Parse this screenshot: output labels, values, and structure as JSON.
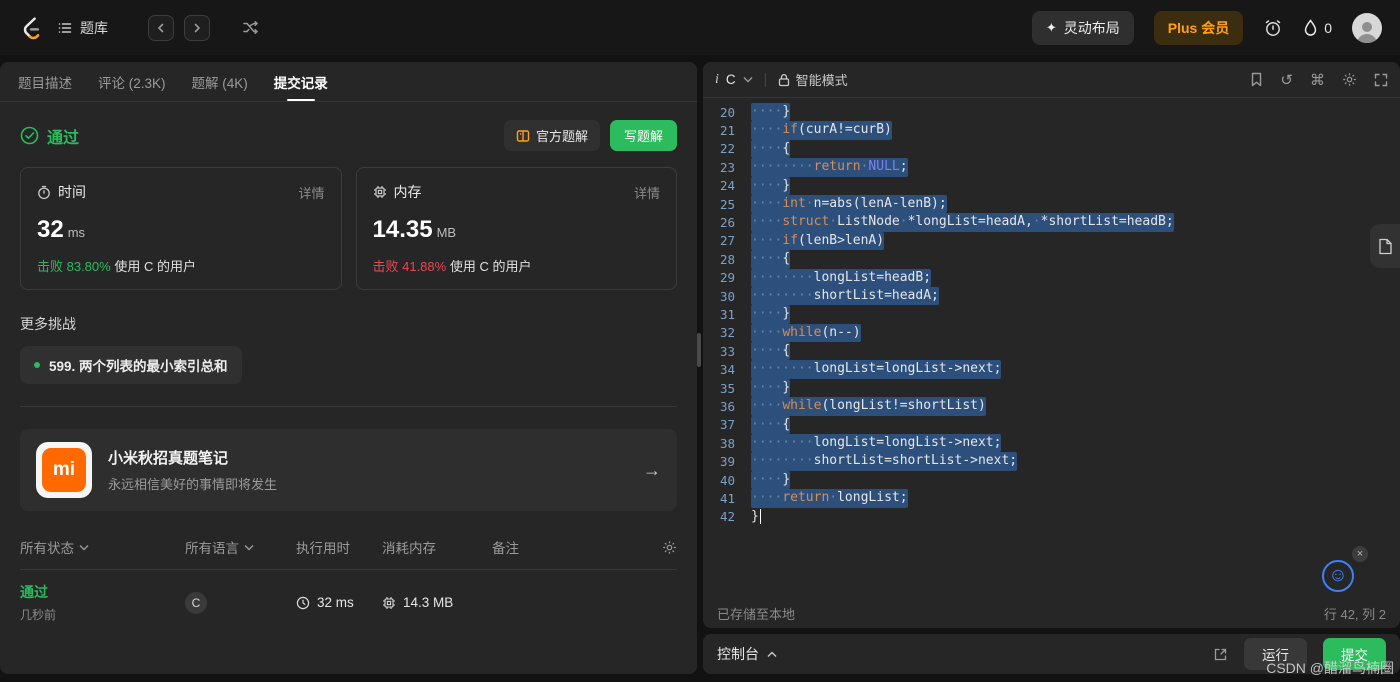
{
  "colors": {
    "green": "#2cbb5d",
    "red": "#f04452",
    "orange": "#ffa116",
    "sel": "#2d4f7c",
    "kw": "#d78d54",
    "const": "#7a83f0",
    "lineno": "#7da0c8"
  },
  "icons": {
    "command": "⌘",
    "reset": "↺",
    "arrow_right": "→",
    "sparkle": "✦",
    "gear": "⚙",
    "smiley": "☺",
    "close": "×",
    "info": "i"
  },
  "topbar": {
    "problem_bank": "题库",
    "layout_button": "灵动布局",
    "plus_button": "Plus 会员",
    "drop_count": "0"
  },
  "left_panel": {
    "tabs": [
      {
        "label": "题目描述"
      },
      {
        "label": "评论 (2.3K)"
      },
      {
        "label": "题解 (4K)"
      },
      {
        "label": "提交记录"
      }
    ],
    "result": {
      "status": "通过",
      "official_solution": "官方题解",
      "write_solution": "写题解"
    },
    "stats": [
      {
        "title": "时间",
        "detail": "详情",
        "value": "32",
        "unit": "ms",
        "beat": "击败 83.80%",
        "users": "使用 C 的用户"
      },
      {
        "title": "内存",
        "detail": "详情",
        "value": "14.35",
        "unit": "MB",
        "beat": "击败 41.88%",
        "users": "使用 C 的用户"
      }
    ],
    "more_challenges": {
      "title": "更多挑战",
      "challenge": "599. 两个列表的最小索引总和"
    },
    "promo": {
      "logo_text": "mi",
      "title": "小米秋招真题笔记",
      "subtitle": "永远相信美好的事情即将发生"
    },
    "table": {
      "filter_status": "所有状态",
      "filter_lang": "所有语言",
      "col_runtime": "执行用时",
      "col_memory": "消耗内存",
      "col_note": "备注",
      "row": {
        "status": "通过",
        "ago": "几秒前",
        "lang": "C",
        "runtime": "32 ms",
        "memory": "14.3 MB"
      }
    }
  },
  "editor": {
    "lang": "C",
    "mode": "智能模式",
    "status_left": "已存储至本地",
    "status_right": "行 42, 列 2",
    "lines": [
      {
        "n": 20,
        "indent": 4,
        "sel": true,
        "tokens": [
          [
            "p",
            "}"
          ]
        ]
      },
      {
        "n": 21,
        "indent": 4,
        "sel": true,
        "tokens": [
          [
            "k",
            "if"
          ],
          [
            "p",
            "(curA!=curB)"
          ]
        ]
      },
      {
        "n": 22,
        "indent": 4,
        "sel": true,
        "tokens": [
          [
            "p",
            "{"
          ]
        ]
      },
      {
        "n": 23,
        "indent": 8,
        "sel": true,
        "tokens": [
          [
            "k",
            "return"
          ],
          [
            "p",
            " "
          ],
          [
            "c",
            "NULL"
          ],
          [
            "p",
            ";"
          ]
        ]
      },
      {
        "n": 24,
        "indent": 4,
        "sel": true,
        "tokens": [
          [
            "p",
            "}"
          ]
        ]
      },
      {
        "n": 25,
        "indent": 4,
        "sel": true,
        "tokens": [
          [
            "k",
            "int"
          ],
          [
            "p",
            " n=abs(lenA-lenB);"
          ]
        ]
      },
      {
        "n": 26,
        "indent": 4,
        "sel": true,
        "tokens": [
          [
            "k",
            "struct"
          ],
          [
            "p",
            " ListNode *longList=headA, *shortList=headB;"
          ]
        ]
      },
      {
        "n": 27,
        "indent": 4,
        "sel": true,
        "tokens": [
          [
            "k",
            "if"
          ],
          [
            "p",
            "(lenB>lenA)"
          ]
        ]
      },
      {
        "n": 28,
        "indent": 4,
        "sel": true,
        "tokens": [
          [
            "p",
            "{"
          ]
        ]
      },
      {
        "n": 29,
        "indent": 8,
        "sel": true,
        "tokens": [
          [
            "p",
            "longList=headB;"
          ]
        ]
      },
      {
        "n": 30,
        "indent": 8,
        "sel": true,
        "tokens": [
          [
            "p",
            "shortList=headA;"
          ]
        ]
      },
      {
        "n": 31,
        "indent": 4,
        "sel": true,
        "tokens": [
          [
            "p",
            "}"
          ]
        ]
      },
      {
        "n": 32,
        "indent": 4,
        "sel": true,
        "tokens": [
          [
            "k",
            "while"
          ],
          [
            "p",
            "(n--)"
          ]
        ]
      },
      {
        "n": 33,
        "indent": 4,
        "sel": true,
        "tokens": [
          [
            "p",
            "{"
          ]
        ]
      },
      {
        "n": 34,
        "indent": 8,
        "sel": true,
        "tokens": [
          [
            "p",
            "longList=longList->next;"
          ]
        ]
      },
      {
        "n": 35,
        "indent": 4,
        "sel": true,
        "tokens": [
          [
            "p",
            "}"
          ]
        ]
      },
      {
        "n": 36,
        "indent": 4,
        "sel": true,
        "tokens": [
          [
            "k",
            "while"
          ],
          [
            "p",
            "(longList!=shortList)"
          ]
        ]
      },
      {
        "n": 37,
        "indent": 4,
        "sel": true,
        "tokens": [
          [
            "p",
            "{"
          ]
        ]
      },
      {
        "n": 38,
        "indent": 8,
        "sel": true,
        "tokens": [
          [
            "p",
            "longList=longList->next;"
          ]
        ]
      },
      {
        "n": 39,
        "indent": 8,
        "sel": true,
        "tokens": [
          [
            "p",
            "shortList=shortList->next;"
          ]
        ]
      },
      {
        "n": 40,
        "indent": 4,
        "sel": true,
        "tokens": [
          [
            "p",
            "}"
          ]
        ]
      },
      {
        "n": 41,
        "indent": 4,
        "sel": true,
        "tokens": [
          [
            "k",
            "return"
          ],
          [
            "p",
            " longList;"
          ]
        ]
      },
      {
        "n": 42,
        "indent": 0,
        "sel": false,
        "cursor": true,
        "tokens": [
          [
            "p",
            "}"
          ]
        ]
      }
    ]
  },
  "console": {
    "label": "控制台",
    "run": "运行",
    "submit": "提交"
  },
  "watermark": "CSDN @醋溜鸟楠圈"
}
